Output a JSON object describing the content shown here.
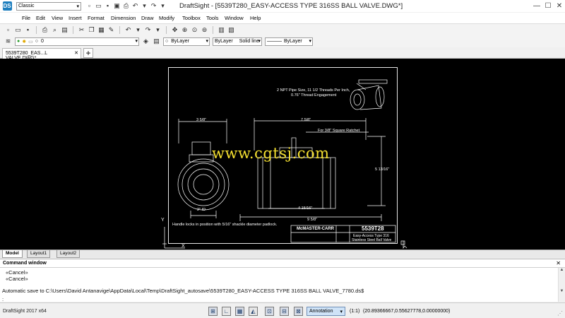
{
  "window": {
    "title": "DraftSight - [5539T280_EASY-ACCESS TYPE 316SS BALL VALVE.DWG*]",
    "workspace": "Classic",
    "logo": "DS"
  },
  "menu": [
    "File",
    "Edit",
    "View",
    "Insert",
    "Format",
    "Dimension",
    "Draw",
    "Modify",
    "Toolbox",
    "Tools",
    "Window",
    "Help"
  ],
  "layer_bar": {
    "layer_value": "0",
    "color": "ByLayer",
    "linetype": "ByLayer",
    "lineweight_style": "Solid line",
    "lineweight": "ByLayer"
  },
  "doc_tab": {
    "label": "5539T280_EAS...L VALVE.DWG*",
    "close": "✕",
    "new_tab": "+"
  },
  "drawing": {
    "watermark": "www.cgtsj.com",
    "callout_top": "2 NPT Pipe Size, 11 1/2 Threads Per Inch,",
    "callout_top_2": "0.76\" Thread Engagement",
    "dim_3_5_8": "3 5/8\"",
    "dim_7_5_8": "7 5/8\"",
    "ratchet_note": "For 3/8\" Square Ratchet",
    "dim_5_13_16": "5 13/16\"",
    "dim_2_id": "2\" ID",
    "dim_4_15_16": "4 15/16\"",
    "dim_9_5_8": "9 5/8\"",
    "handle_note": "Handle locks in position with 5/16\" shackle diameter padlock.",
    "tb_company": "McMASTER-CARR",
    "tb_part": "5539T28",
    "tb_desc_1": "Easy-Access Type 316",
    "tb_desc_2": "Stainless Steel Ball Valve",
    "axis_y": "Y",
    "axis_x": "X"
  },
  "layout_tabs": [
    "Model",
    "Layout1",
    "Layout2"
  ],
  "command_window": {
    "title": "Command window",
    "lines": [
      "«Cancel»",
      "«Cancel»",
      "Automatic save to C:\\Users\\David Antanavige\\AppData\\Local\\Temp\\DraftSight_autosave\\5539T280_EASY-ACCESS TYPE 316SS BALL VALVE_7780.ds$",
      ":"
    ]
  },
  "status": {
    "app_version": "DraftSight 2017 x64",
    "annotation": "Annotation",
    "scale": "(1:1)",
    "coordinates": "(20.89366667,0.55627778,0.00000000)"
  }
}
